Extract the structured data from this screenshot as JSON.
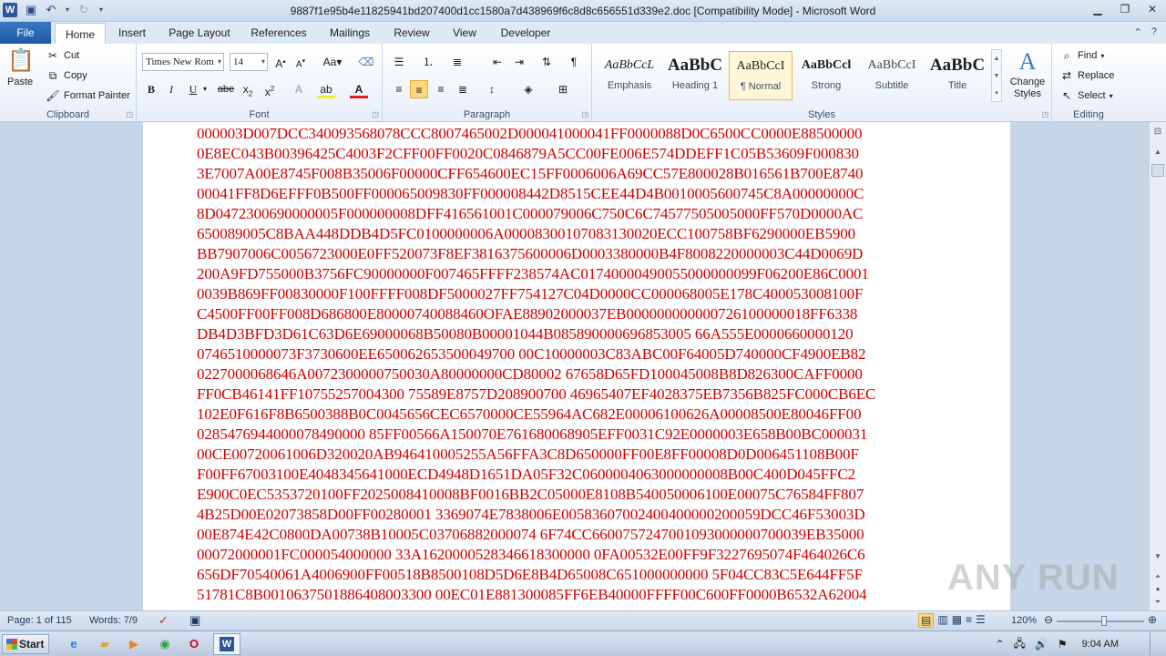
{
  "titlebar": {
    "app_icon": "W",
    "title": "9887f1e95b4e11825941bd207400d1cc1580a7d438969f6c8d8c656551d339e2.doc [Compatibility Mode]  -  Microsoft Word"
  },
  "tabs": {
    "file": "File",
    "items": [
      "Home",
      "Insert",
      "Page Layout",
      "References",
      "Mailings",
      "Review",
      "View",
      "Developer"
    ],
    "active": "Home"
  },
  "clipboard": {
    "paste": "Paste",
    "cut": "Cut",
    "copy": "Copy",
    "format_painter": "Format Painter",
    "label": "Clipboard"
  },
  "font": {
    "name": "Times New Rom",
    "size": "14",
    "label": "Font"
  },
  "paragraph": {
    "label": "Paragraph"
  },
  "styles": {
    "items": [
      {
        "preview": "AaBbCcL",
        "name": "Emphasis"
      },
      {
        "preview": "AaBbC",
        "name": "Heading 1"
      },
      {
        "preview": "AaBbCcI",
        "name": "¶ Normal"
      },
      {
        "preview": "AaBbCcl",
        "name": "Strong"
      },
      {
        "preview": "AaBbCcI",
        "name": "Subtitle"
      },
      {
        "preview": "AaBbC",
        "name": "Title"
      }
    ],
    "change_styles": "Change Styles",
    "label": "Styles"
  },
  "editing": {
    "find": "Find",
    "replace": "Replace",
    "select": "Select",
    "label": "Editing"
  },
  "document": {
    "lines": [
      "000003D007DCC340093568078CCC8007465002D000041000041FF0000088D0C6500CC0000E88500000",
      "0E8EC043B00396425C4003F2CFF00FF0020C0846879A5CC00FE006E574DDEFF1C05B53609F000830",
      "3E7007A00E8745F008B35006F00000CFF654600EC15FF0006006A69CC57E800028B016561B700E8740",
      "00041FF8D6EFFF0B500FF000065009830FF000008442D8515CEE44D4B0010005600745C8A00000000C",
      "8D0472300690000005F000000008DFF416561001C000079006C750C6C74577505005000FF570D0000AC",
      "650089005C8BAA448DDB4D5FC0100000006A00008300107083130020ECC100758BF6290000EB5900",
      "BB7907006C0056723000E0FF520073F8EF3816375600006D0003380000B4F8008220000003C44D0069D",
      "200A9FD755000B3756FC90000000F007465FFFF238574AC01740000490055000000099F06200E86C0001",
      "0039B869FF00830000F100FFFF008DF5000027FF754127C04D0000CC000068005E178C400053008100F",
      "C4500FF00FF008D686800E80000740088460OFAE88902000037EB000000000000726100000018FF6338",
      "DB4D3BFD3D61C63D6E69000068B50080B00001044B085890000696853005 66A555E0000660000120",
      "0746510000073F3730600EE650062653500049700 00C10000003C83ABC00F64005D740000CF4900EB82",
      "0227000068646A0072300000750030A80000000CD80002 67658D65FD100045008B8D826300CAFF0000",
      "FF0CB46141FF10755257004300 75589E8757D208900700 46965407EF4028375EB7356B825FC000CB6EC",
      "102E0F616F8B6500388B0C0045656CEC6570000CE55964AC682E00006100626A00008500E80046FF00",
      "0285476944000078490000 85FF00566A150070E761680068905EFF0031C92E0000003E658B00BC000031",
      "00CE00720061006D320020AB946410005255A56FFA3C8D650000FF00E8FF00008D0D006451108B00F",
      "F00FF67003100E4048345641000ECD4948D1651DA05F32C0600004063000000008B00C400D045FFC2",
      "E900C0EC5353720100FF2025008410008BF0016BB2C05000E8108B540050006100E00075C76584FF807",
      "4B25D00E02073858D00FF00280001 3369074E7838006E00583607002400400000200059DCC46F53003D",
      "00E874E42C0800DA00738B10005C03706882000074 6F74CC6600757247001093000000700039EB35000",
      "00072000001FC000054000000 33A1620000528346618300000 0FA00532E00FF9F3227695074F464026C6",
      "656DF70540061A4006900FF00518B8500108D5D6E8B4D65008C651000000000 5F04CC83C5E644FF5F",
      "51781C8B0010637501886408003300 00EC01E881300085FF6EB40000FFFF00C600FF0000B6532A62004"
    ]
  },
  "statusbar": {
    "page": "Page: 1 of 115",
    "words": "Words: 7/9",
    "zoom": "120%"
  },
  "watermark": "ANY RUN",
  "taskbar": {
    "start": "Start",
    "time": "9:04 AM"
  }
}
